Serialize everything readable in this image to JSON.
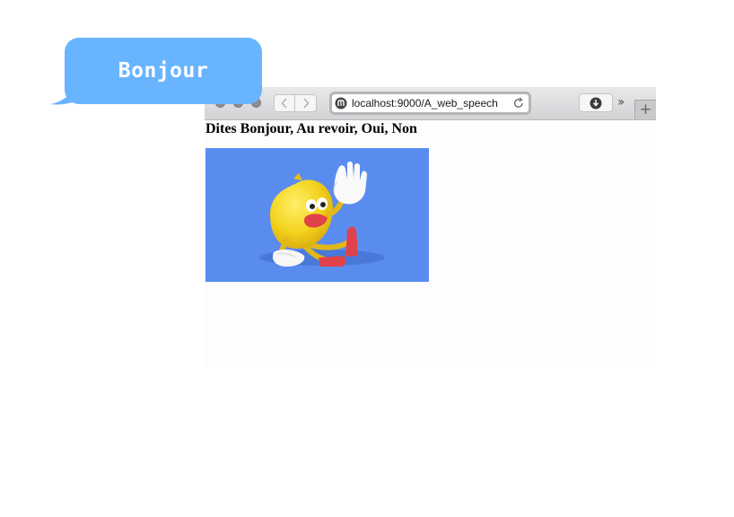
{
  "bubble": {
    "text": "Bonjour",
    "color": "#69b4ff"
  },
  "browser": {
    "url": "localhost:9000/A_web_speech",
    "icons": {
      "traffic_lights": [
        "close-icon",
        "minimize-icon",
        "zoom-icon"
      ],
      "back": "chevron-left-icon",
      "forward": "chevron-right-icon",
      "site": "site-icon",
      "reload": "reload-icon",
      "download": "download-icon",
      "overflow": "double-chevron-icon",
      "new_tab": "plus-icon"
    },
    "new_tab_label": "+"
  },
  "page": {
    "heading": "Dites Bonjour, Au revoir, Oui, Non",
    "image": {
      "subject": "waving-lemon-character",
      "background_color": "#5a8cf0",
      "character_color": "#f2d21c",
      "accent_color": "#e8464b"
    }
  }
}
